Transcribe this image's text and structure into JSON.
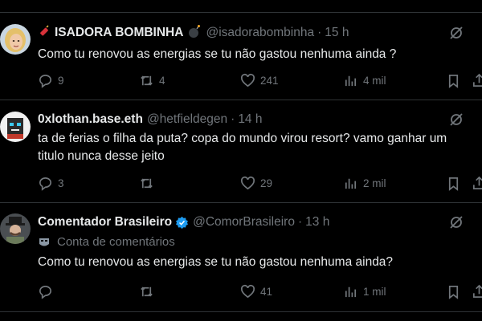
{
  "tweets": [
    {
      "name": "ISADORA BOMBINHA",
      "handle": "@isadorabombinha",
      "time": "15 h",
      "text": "Como tu renovou as energias se tu não gastou nenhuma ainda ?",
      "replies": "9",
      "reposts": "4",
      "likes": "241",
      "views": "4 mil"
    },
    {
      "name": "0xlothan.base.eth",
      "handle": "@hetfieldegen",
      "time": "14 h",
      "text": "ta de ferias o filha da puta? copa do mundo virou resort? vamo ganhar um titulo nunca desse jeito",
      "replies": "3",
      "reposts": "",
      "likes": "29",
      "views": "2 mil"
    },
    {
      "name": "Comentador Brasileiro",
      "handle": "@ComorBrasileiro",
      "time": "13 h",
      "community": "Conta de comentários",
      "text": "Como tu renovou as energias se tu não gastou nenhuma ainda?",
      "replies": "",
      "reposts": "",
      "likes": "41",
      "views": "1 mil"
    }
  ],
  "separator": "·",
  "colors": {
    "background": "#000000",
    "text": "#e7e9ea",
    "muted": "#71767b",
    "divider": "#2f3336",
    "verified": "#1d9bf0"
  },
  "icons": [
    "reply-icon",
    "repost-icon",
    "like-icon",
    "views-icon",
    "bookmark-icon",
    "share-icon",
    "grok-icon",
    "verified-badge-icon",
    "community-icon",
    "firecracker-icon",
    "bomb-icon"
  ]
}
